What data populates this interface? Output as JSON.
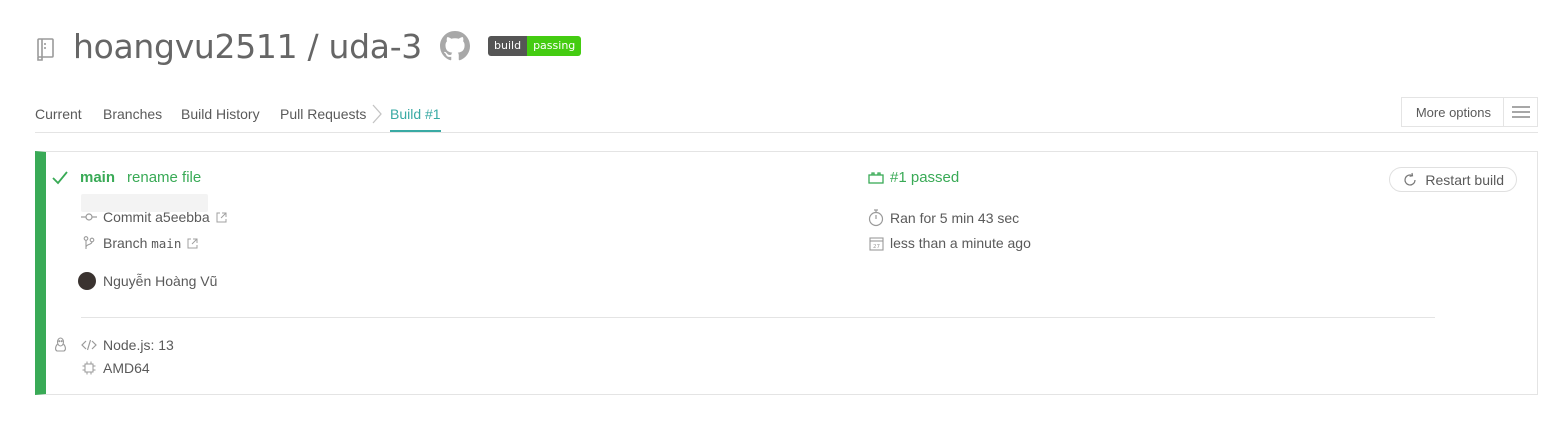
{
  "header": {
    "repo_title": "hoangvu2511 / uda-3",
    "badge_left": "build",
    "badge_right": "passing"
  },
  "tabs": {
    "current": "Current",
    "branches": "Branches",
    "build_history": "Build History",
    "pull_requests": "Pull Requests",
    "build": "Build #1",
    "more_options": "More options"
  },
  "build": {
    "branch": "main",
    "commit_message": "rename file",
    "commit_label": "Commit",
    "commit_sha": "a5eebba",
    "branch_label": "Branch",
    "branch_value": "main",
    "author": "Nguyễn Hoàng Vũ",
    "status": "#1 passed",
    "duration": "Ran for 5 min 43 sec",
    "finished": "less than a minute ago",
    "restart_label": "Restart build",
    "language": "Node.js: 13",
    "arch": "AMD64"
  },
  "colors": {
    "passed": "#39aa56",
    "accent": "#39aaa4",
    "badge_gray": "#555555",
    "badge_green": "#44cc11"
  },
  "icons": [
    "repo-icon",
    "github-icon",
    "check-icon",
    "commit-icon",
    "external-link-icon",
    "branch-icon",
    "build-status-icon",
    "stopwatch-icon",
    "calendar-icon",
    "restart-icon",
    "linux-icon",
    "code-icon",
    "cpu-icon",
    "menu-icon",
    "chevron-right-icon"
  ]
}
